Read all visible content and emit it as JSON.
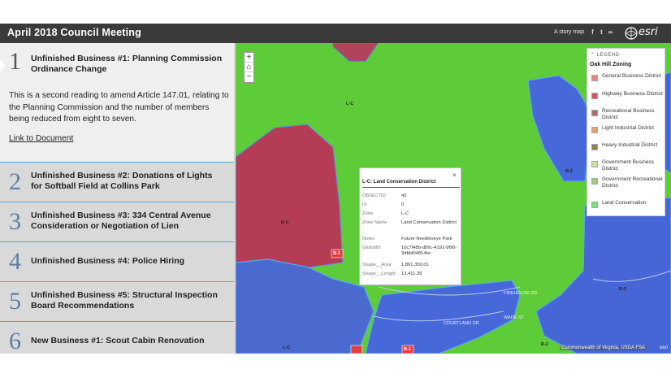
{
  "header": {
    "title": "April 2018 Council Meeting",
    "story_label": "A story map",
    "brand": "esri"
  },
  "sidebar": {
    "items": [
      {
        "number": "1",
        "title": "Unfinished Business #1: Planning Commission Ordinance Change"
      },
      {
        "number": "2",
        "title": "Unfinished Business #2: Donations of Lights for Softball Field at Collins Park"
      },
      {
        "number": "3",
        "title": "Unfinished Business #3: 334 Central Avenue Consideration or Negotiation of Lien"
      },
      {
        "number": "4",
        "title": "Unfinished Business #4: Police Hiring"
      },
      {
        "number": "5",
        "title": "Unfinished Business #5: Structural Inspection Board Recommendations"
      },
      {
        "number": "6",
        "title": "New Business #1: Scout Cabin Renovation"
      }
    ],
    "body": "This is a second reading to amend Article 147.01, relating to the Planning Commission and the number of members being reduced from eight to seven.",
    "link": "Link to Document"
  },
  "map": {
    "zoom_in": "+",
    "zoom_out": "−",
    "home": "⌂",
    "legend": {
      "header": "LEGEND",
      "title": "Oak Hill Zoning",
      "items": [
        {
          "label": "General Business District",
          "color": "#f08080"
        },
        {
          "label": "Highway Business District",
          "color": "#e0505a"
        },
        {
          "label": "Recreational Business District",
          "color": "#b06a6a"
        },
        {
          "label": "Light Industrial District",
          "color": "#e8a070"
        },
        {
          "label": "Heavy Industrial District",
          "color": "#9a7a4a"
        },
        {
          "label": "Government Business District",
          "color": "#c9e6a0"
        },
        {
          "label": "Government Recreational District",
          "color": "#a8c87a"
        },
        {
          "label": "Land Conservation",
          "color": "#7ee07a"
        }
      ]
    },
    "popup": {
      "title": "L-C: Land Conservation District",
      "close": "×",
      "rows": [
        {
          "key": "OBJECTID",
          "value": "43"
        },
        {
          "key": "Id",
          "value": "0"
        },
        {
          "key": "Zone",
          "value": "L-C"
        },
        {
          "key": "Zone Name",
          "value": "Land Conservation District"
        },
        {
          "key": "Notes",
          "value": "Future Needleseye Park"
        },
        {
          "key": "GlobalID",
          "value": "1bc7f48b-d56c-4191-9f90-3dfdd04814bc"
        },
        {
          "key": "Shape__Area",
          "value": "1,891,350.01"
        },
        {
          "key": "Shape__Length",
          "value": "13,411.39"
        }
      ]
    },
    "labels": {
      "lc1": "L-C",
      "lc2": "L-C",
      "rc": "R-C",
      "r2a": "R-2",
      "r2b": "R-2",
      "r2c": "R-2",
      "b1": "B-1",
      "b2": "B-1",
      "street1": "FIREHOUSE RD",
      "street2": "WADE ST",
      "street3": "COURTLAND DR"
    },
    "credit": "Commonwealth of Virginia, USDA FSA",
    "powered": "esri"
  }
}
